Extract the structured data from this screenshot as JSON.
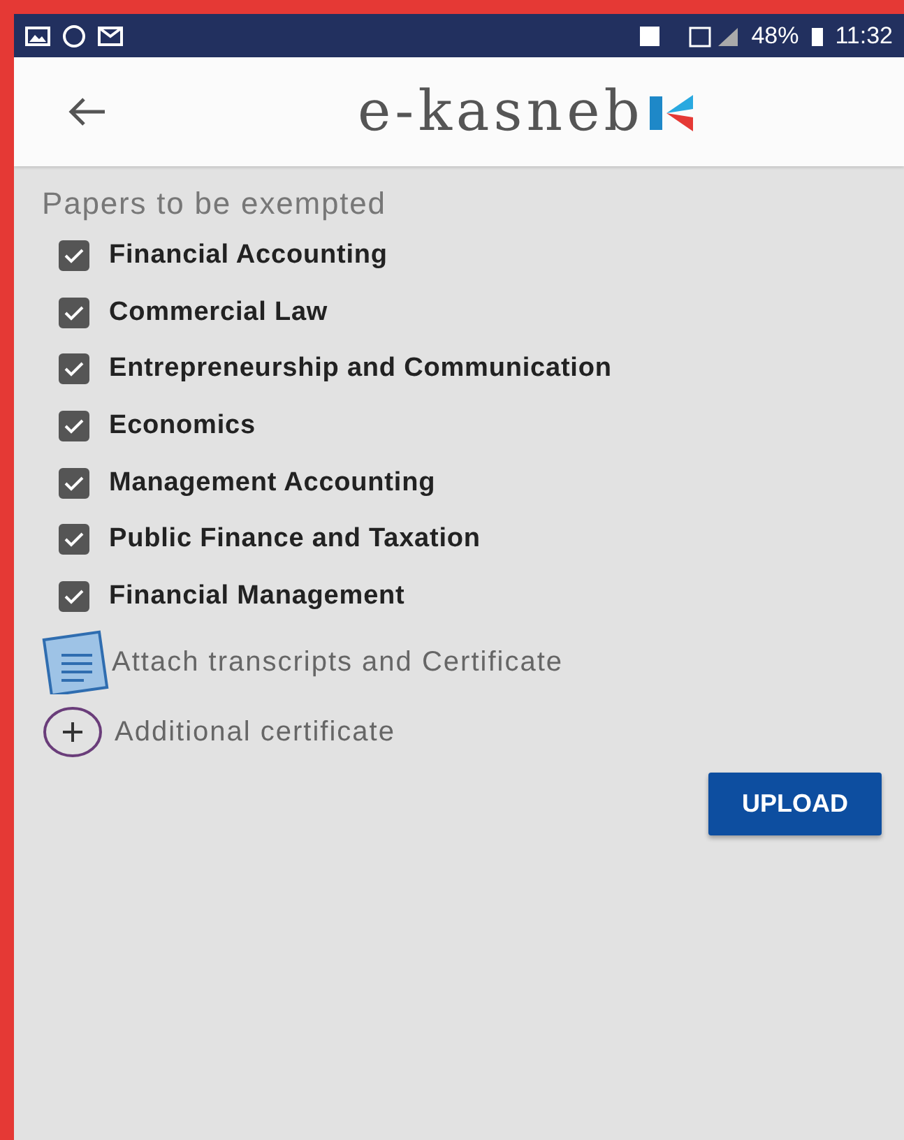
{
  "status_bar": {
    "battery": "48%",
    "time": "11:32"
  },
  "app_bar": {
    "title": "e-kasneb"
  },
  "section_title": "Papers to be exempted",
  "papers": [
    {
      "label": "Financial Accounting",
      "checked": true
    },
    {
      "label": "Commercial Law",
      "checked": true
    },
    {
      "label": "Entrepreneurship and Communication",
      "checked": true
    },
    {
      "label": "Economics",
      "checked": true
    },
    {
      "label": "Management Accounting",
      "checked": true
    },
    {
      "label": "Public Finance and Taxation",
      "checked": true
    },
    {
      "label": "Financial Management",
      "checked": true
    }
  ],
  "attach_label": "Attach transcripts and Certificate",
  "additional_label": "Additional certificate",
  "upload_button": "UPLOAD"
}
